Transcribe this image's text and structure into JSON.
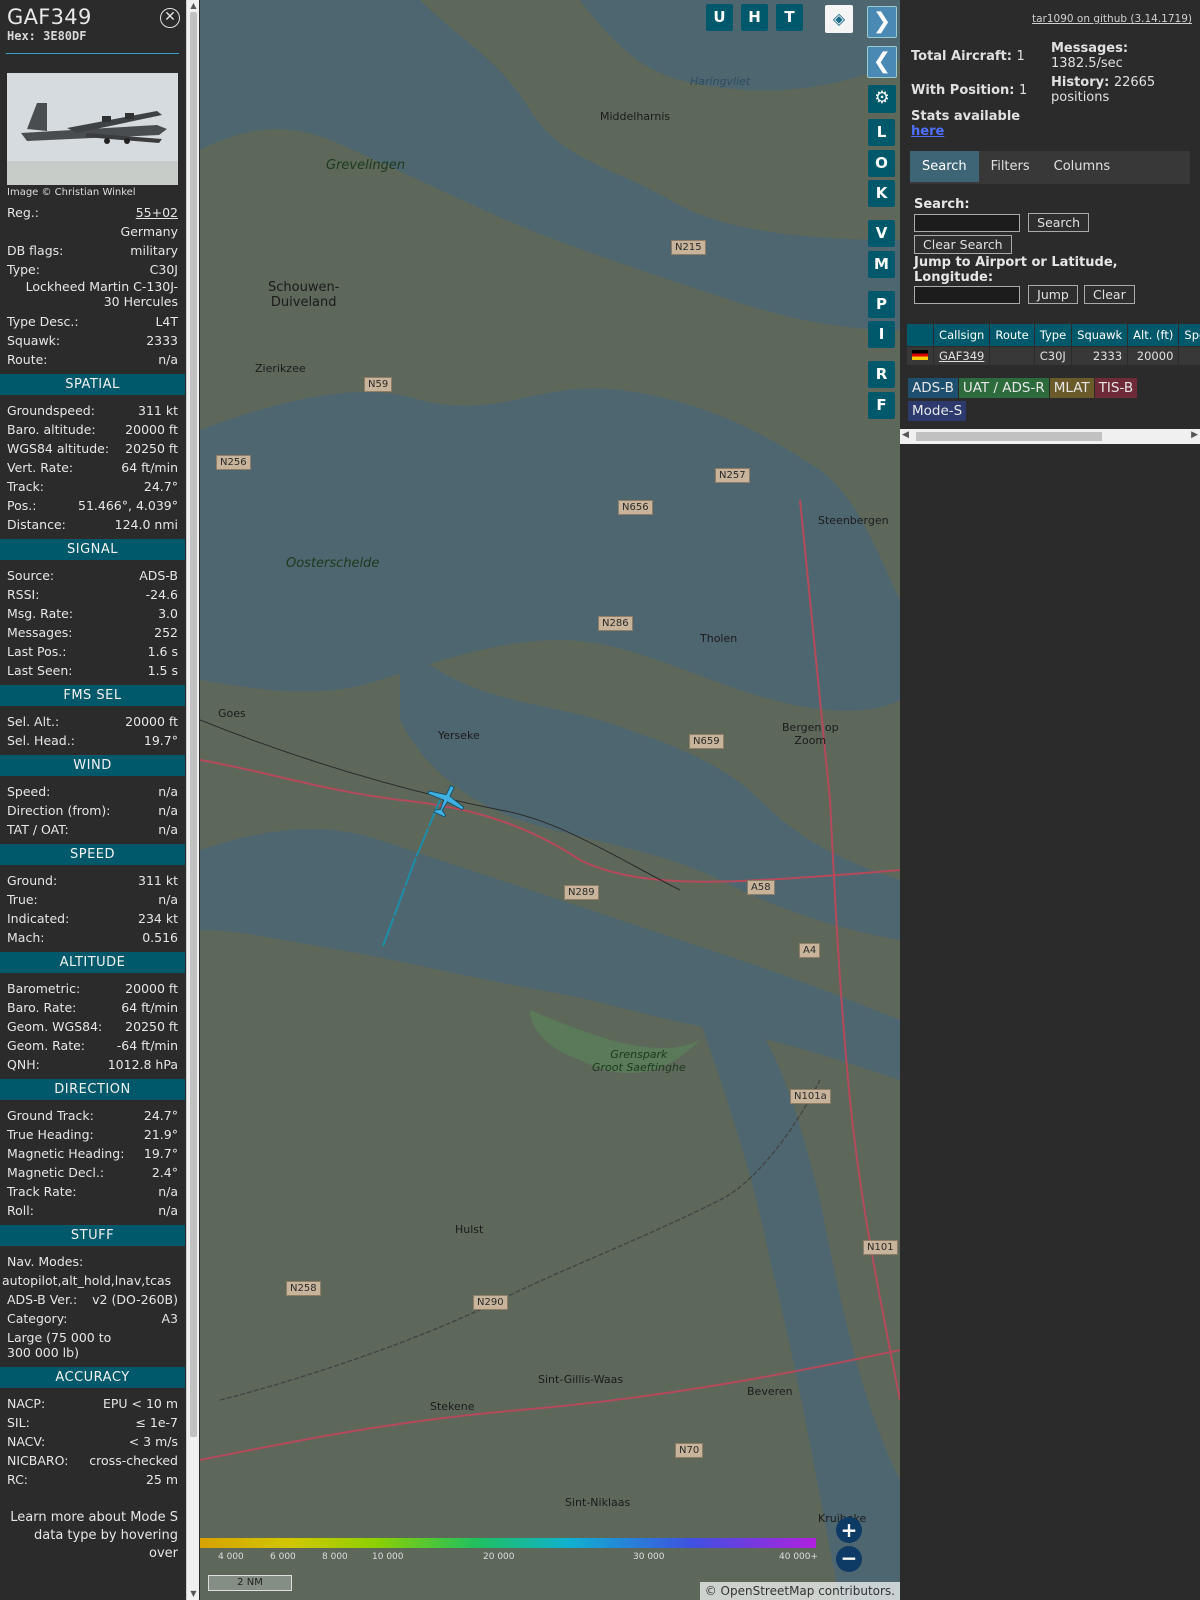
{
  "aircraft": {
    "callsign": "GAF349",
    "hex": "Hex: 3E80DF",
    "photo_credit": "Image © Christian Winkel",
    "close_glyph": "⊗"
  },
  "info": [
    {
      "k": "Reg.:",
      "v": "55+02"
    },
    {
      "k": "",
      "v": "Germany"
    },
    {
      "k": "DB flags:",
      "v": "military"
    },
    {
      "k": "Type:",
      "v": "C30J"
    },
    {
      "k": "",
      "v": "Lockheed Martin C-130J-30 Hercules"
    },
    {
      "k": "Type Desc.:",
      "v": "L4T"
    },
    {
      "k": "Squawk:",
      "v": "2333"
    },
    {
      "k": "Route:",
      "v": "n/a"
    }
  ],
  "sections": {
    "spatial": {
      "title": "SPATIAL",
      "rows": [
        {
          "k": "Groundspeed:",
          "v": "311 kt"
        },
        {
          "k": "Baro. altitude:",
          "v": "20000 ft"
        },
        {
          "k": "WGS84 altitude:",
          "v": "20250 ft"
        },
        {
          "k": "Vert. Rate:",
          "v": "64 ft/min"
        },
        {
          "k": "Track:",
          "v": "24.7°"
        },
        {
          "k": "Pos.:",
          "v": "51.466°, 4.039°"
        },
        {
          "k": "Distance:",
          "v": "124.0 nmi"
        }
      ]
    },
    "signal": {
      "title": "SIGNAL",
      "rows": [
        {
          "k": "Source:",
          "v": "ADS-B"
        },
        {
          "k": "RSSI:",
          "v": "-24.6"
        },
        {
          "k": "Msg. Rate:",
          "v": "3.0"
        },
        {
          "k": "Messages:",
          "v": "252"
        },
        {
          "k": "Last Pos.:",
          "v": "1.6 s"
        },
        {
          "k": "Last Seen:",
          "v": "1.5 s"
        }
      ]
    },
    "fms": {
      "title": "FMS SEL",
      "rows": [
        {
          "k": "Sel. Alt.:",
          "v": "20000 ft"
        },
        {
          "k": "Sel. Head.:",
          "v": "19.7°"
        }
      ]
    },
    "wind": {
      "title": "WIND",
      "rows": [
        {
          "k": "Speed:",
          "v": "n/a"
        },
        {
          "k": "Direction (from):",
          "v": "n/a"
        },
        {
          "k": "TAT / OAT:",
          "v": "n/a"
        }
      ]
    },
    "speed": {
      "title": "SPEED",
      "rows": [
        {
          "k": "Ground:",
          "v": "311 kt"
        },
        {
          "k": "True:",
          "v": "n/a"
        },
        {
          "k": "Indicated:",
          "v": "234 kt"
        },
        {
          "k": "Mach:",
          "v": "0.516"
        }
      ]
    },
    "altitude": {
      "title": "ALTITUDE",
      "rows": [
        {
          "k": "Barometric:",
          "v": "20000 ft"
        },
        {
          "k": "Baro. Rate:",
          "v": "64 ft/min"
        },
        {
          "k": "Geom. WGS84:",
          "v": "20250 ft"
        },
        {
          "k": "Geom. Rate:",
          "v": "-64 ft/min"
        },
        {
          "k": "QNH:",
          "v": "1012.8 hPa"
        }
      ]
    },
    "direction": {
      "title": "DIRECTION",
      "rows": [
        {
          "k": "Ground Track:",
          "v": "24.7°"
        },
        {
          "k": "True Heading:",
          "v": "21.9°"
        },
        {
          "k": "Magnetic Heading:",
          "v": "19.7°"
        },
        {
          "k": "Magnetic Decl.:",
          "v": "2.4°"
        },
        {
          "k": "Track Rate:",
          "v": "n/a"
        },
        {
          "k": "Roll:",
          "v": "n/a"
        }
      ]
    },
    "stuff": {
      "title": "STUFF",
      "nav_label": "Nav. Modes:",
      "nav_value": "autopilot,alt_hold,lnav,tcas",
      "adsb_label": "ADS-B Ver.:",
      "adsb_value": "v2 (DO-260B)",
      "cat_label": "Category:",
      "cat_value": "A3",
      "cat_desc": "Large (75 000 to 300 000 lb)"
    },
    "accuracy": {
      "title": "ACCURACY",
      "rows": [
        {
          "k": "NACP:",
          "v": "EPU < 10 m",
          "k1": "NAC",
          "sub": "P",
          ":": ":"
        },
        {
          "k": "SIL:",
          "v": "≤ 1e-7"
        },
        {
          "k": "NACV:",
          "v": "< 3 m/s",
          "k1": "NAC",
          "sub": "V"
        },
        {
          "k": "NICBARO:",
          "v": "cross-checked",
          "k1": "NIC",
          "sub": "BARO"
        },
        {
          "k": "RC:",
          "v": "25 m",
          "k1": "R",
          "sub": "C"
        }
      ]
    },
    "footer_text": "Learn more about Mode S data type by hovering over"
  },
  "map_buttons": {
    "top": [
      "U",
      "H",
      "T"
    ],
    "side": [
      "L",
      "O",
      "K",
      "V",
      "M",
      "P",
      "I",
      "R",
      "F"
    ]
  },
  "map_labels": [
    {
      "t": "Haringvliet",
      "c": "it"
    },
    {
      "t": "Middelharnis",
      "c": ""
    },
    {
      "t": "Grevelingen",
      "c": "big"
    },
    {
      "t": "Schouwen-\nDuiveland",
      "c": ""
    },
    {
      "t": "Zierikzee",
      "c": ""
    },
    {
      "t": "Oosterschelde",
      "c": "big"
    },
    {
      "t": "Goes",
      "c": ""
    },
    {
      "t": "Yerseke",
      "c": ""
    },
    {
      "t": "Tholen",
      "c": ""
    },
    {
      "t": "Bergen op\nZoom",
      "c": ""
    },
    {
      "t": "Steenbergen",
      "c": ""
    },
    {
      "t": "Hulst",
      "c": ""
    },
    {
      "t": "Sint-Gillis-Waas",
      "c": ""
    },
    {
      "t": "Stekene",
      "c": ""
    },
    {
      "t": "Beveren",
      "c": ""
    },
    {
      "t": "Sint-Niklaas",
      "c": ""
    },
    {
      "t": "Kruibeke",
      "c": ""
    },
    {
      "t": "Grenspark\nGroot Saeftinghe",
      "c": "big"
    }
  ],
  "roads": [
    "N215",
    "N59",
    "N256",
    "N257",
    "N656",
    "N286",
    "N659",
    "N289",
    "A58",
    "A4",
    "N101a",
    "N101",
    "N258",
    "N290",
    "N70"
  ],
  "altitude_scale": [
    "4 000",
    "6 000",
    "8 000",
    "10 000",
    "20 000",
    "30 000",
    "40 000+"
  ],
  "scale_bar": "2 NM",
  "attribution": "© OpenStreetMap contributors.",
  "right": {
    "github_link": "tar1090 on github (3.14.1719)",
    "total_label": "Total Aircraft:",
    "total_value": "1",
    "withpos_label": "With Position:",
    "withpos_value": "1",
    "messages_label": "Messages:",
    "messages_value": "1382.5/sec",
    "history_label": "History:",
    "history_value": "22665 positions",
    "stats_label": "Stats available",
    "stats_link": "here",
    "tabs": [
      "Search",
      "Filters",
      "Columns"
    ],
    "search_label": "Search:",
    "search_btn": "Search",
    "clear_search_btn": "Clear Search",
    "jump_label": "Jump to Airport or Latitude, Longitude:",
    "jump_btn": "Jump",
    "clear_btn": "Clear",
    "table_headers": [
      "",
      "Callsign",
      "Route",
      "Type",
      "Squawk",
      "Alt. (ft)",
      "Spd."
    ],
    "table_row": {
      "callsign": "GAF349",
      "route": "",
      "type": "C30J",
      "squawk": "2333",
      "alt": "20000",
      "spd": ""
    },
    "badges": [
      {
        "label": "ADS-B",
        "color": "#1f4f6e"
      },
      {
        "label": "UAT / ADS-R",
        "color": "#2d6b3c"
      },
      {
        "label": "MLAT",
        "color": "#6b5a2a"
      },
      {
        "label": "TIS-B",
        "color": "#6e2a36"
      },
      {
        "label": "Mode-S",
        "color": "#2c3a6e"
      }
    ]
  }
}
